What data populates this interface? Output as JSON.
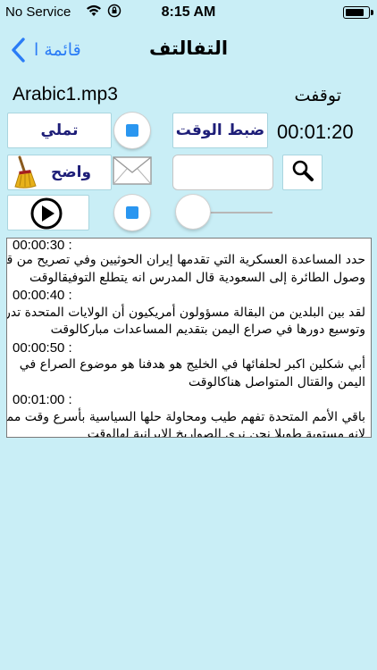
{
  "status": {
    "carrier": "No Service",
    "time": "8:15 AM",
    "battery_level": 0.85
  },
  "nav": {
    "back_label": "قائمة ا",
    "title": "التفالتف"
  },
  "player": {
    "file_name": "Arabic1.mp3",
    "state_label": "توقفت",
    "timer": "00:01:20",
    "dictate_label": "تملي",
    "set_time_label": "ضبط الوقت",
    "clear_label": "واضح",
    "search_value": "",
    "slider_position": 0.0
  },
  "icons": {
    "back": "chevron-left-icon",
    "wifi": "wifi-icon",
    "lock": "orientation-lock-icon",
    "battery": "battery-icon",
    "stop": "stop-icon",
    "mail": "envelope-icon",
    "search": "magnifier-icon",
    "broom": "broom-icon",
    "play": "play-icon"
  },
  "colors": {
    "background": "#c9eef6",
    "accent": "#2a7cf6",
    "button_text": "#1e1e78",
    "stop": "#2a96f0"
  },
  "transcript": [
    {
      "kind": "ts",
      "text": "00:00:30 :"
    },
    {
      "kind": "tx",
      "text": "حدد المساعدة العسكرية التي تقدمها إيران الحوثيين وفي تصريح من قبل"
    },
    {
      "kind": "tx",
      "text": "وصول الطائرة إلى السعودية قال المدرس انه يتطلع التوفيقالوقت"
    },
    {
      "kind": "ts",
      "text": "00:00:40 :"
    },
    {
      "kind": "tx",
      "text": "لقد بين البلدين من البقالة مسؤولون أمريكيون أن الولايات المتحدة تدرس"
    },
    {
      "kind": "tx",
      "text": "وتوسيع دورها في صراع اليمن بتقديم المساعدات مباركالوقت"
    },
    {
      "kind": "ts",
      "text": "00:00:50 :"
    },
    {
      "kind": "tx",
      "text": "أبي شكلين اكبر لحلفائها في الخليج هو هدفنا هو موضوع الصراع في"
    },
    {
      "kind": "tx",
      "text": "اليمن والقتال المتواصل هناكالوقت"
    },
    {
      "kind": "ts",
      "text": "00:01:00 :"
    },
    {
      "kind": "tx",
      "text": "باقي الأمم المتحدة تفهم طيب ومحاولة حلها السياسية بأسرع وقت ممكن"
    },
    {
      "kind": "tx",
      "text": "لانه مستوية طويلا نحن نرى الصواريخ الايرانية لهالوقت"
    }
  ]
}
